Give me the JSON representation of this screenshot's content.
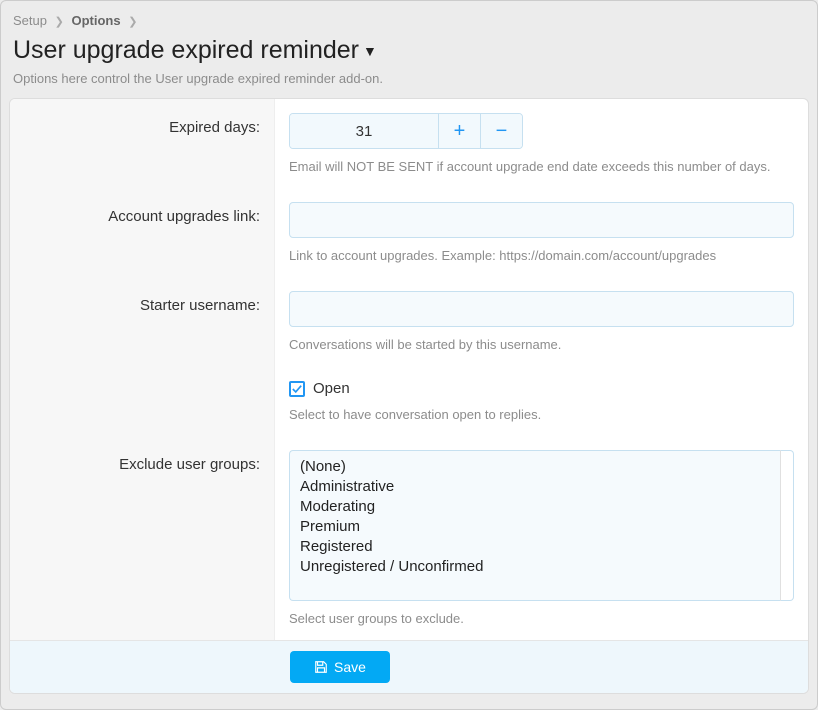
{
  "breadcrumb": {
    "root": "Setup",
    "current": "Options"
  },
  "page": {
    "title": "User upgrade expired reminder",
    "description": "Options here control the User upgrade expired reminder add-on."
  },
  "form": {
    "expired_days": {
      "label": "Expired days:",
      "value": "31",
      "hint": "Email will NOT BE SENT if account upgrade end date exceeds this number of days."
    },
    "upgrades_link": {
      "label": "Account upgrades link:",
      "value": "",
      "hint": "Link to account upgrades. Example: https://domain.com/account/upgrades"
    },
    "starter_username": {
      "label": "Starter username:",
      "value": "",
      "hint": "Conversations will be started by this username."
    },
    "open": {
      "label": "Open",
      "checked": true,
      "hint": "Select to have conversation open to replies."
    },
    "exclude_groups": {
      "label": "Exclude user groups:",
      "options": [
        "(None)",
        "Administrative",
        "Moderating",
        "Premium",
        "Registered",
        "Unregistered / Unconfirmed"
      ],
      "hint": "Select user groups to exclude."
    }
  },
  "actions": {
    "save": "Save"
  }
}
